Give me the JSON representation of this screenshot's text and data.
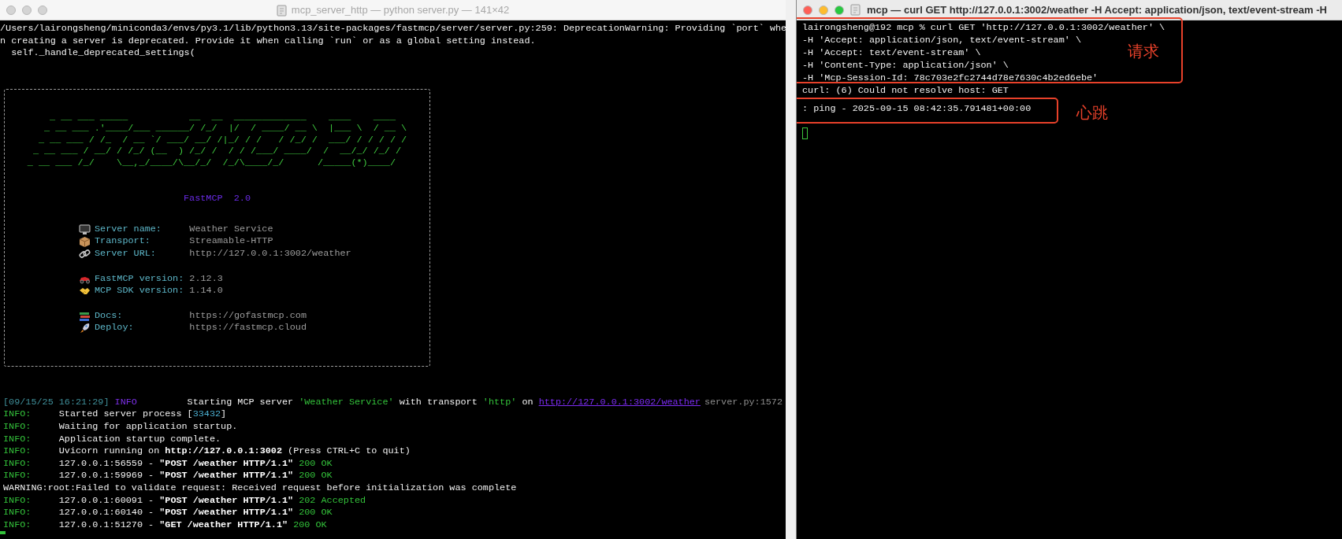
{
  "left_window": {
    "title": "mcp_server_http — python server.py — 141×42",
    "active": false,
    "output": [
      "/Users/lairongsheng/miniconda3/envs/py3.1/lib/python3.13/site-packages/fastmcp/server/server.py:259: DeprecationWarning: Providing `port` whe",
      "n creating a server is deprecated. Provide it when calling `run` or as a global setting instead.",
      "  self._handle_deprecated_settings("
    ],
    "banner": {
      "art": [
        "    _ __ ___ _____           __  __  _____________    ____    ____",
        "   _ __ ___ .'____/___ ______/ /_/  |/  / ____/ __ \\  |___ \\  / __ \\",
        "  _ __ ___ / /_  / __ `/ ___/ __/ /|_/ / /   / /_/ /  ___/ / / / / /",
        " _ __ ___ / __/ / /_/ (__  ) /_/ /  / / /___/ ____/  /  __/_/ /_/ /",
        "_ __ ___ /_/    \\__,_/____/\\__/_/  /_/\\____/_/      /_____(*)____/"
      ],
      "title": "FastMCP  2.0",
      "groups": [
        [
          {
            "kind": "monitor",
            "label": "Server name:",
            "value": "Weather Service"
          },
          {
            "kind": "package",
            "label": "Transport:",
            "value": "Streamable-HTTP"
          },
          {
            "kind": "link",
            "label": "Server URL:",
            "value": "http://127.0.0.1:3002/weather"
          }
        ],
        [
          {
            "kind": "car",
            "label": "FastMCP version:",
            "value": "2.12.3"
          },
          {
            "kind": "handshake",
            "label": "MCP SDK version:",
            "value": "1.14.0"
          }
        ],
        [
          {
            "kind": "books",
            "label": "Docs:",
            "value": "https://gofastmcp.com"
          },
          {
            "kind": "rocket",
            "label": "Deploy:",
            "value": "https://fastmcp.cloud"
          }
        ]
      ]
    },
    "log": [
      {
        "kind": "rich",
        "timestamp": "[09/15/25 16:21:29]",
        "level": "INFO",
        "segments": [
          {
            "kind": "plain",
            "text": "Starting MCP server "
          },
          {
            "kind": "quoted",
            "text": "'Weather Service'"
          },
          {
            "kind": "plain",
            "text": " with transport "
          },
          {
            "kind": "quoted",
            "text": "'http'"
          },
          {
            "kind": "plain",
            "text": " on "
          },
          {
            "kind": "url",
            "text": "http://127.0.0.1:3002/weather"
          }
        ],
        "source": "server.py:1572"
      },
      {
        "kind": "uvicorn",
        "level": "INFO:",
        "segments": [
          {
            "kind": "plain",
            "text": "Started server process ["
          },
          {
            "kind": "number",
            "text": "33432"
          },
          {
            "kind": "plain",
            "text": "]"
          }
        ]
      },
      {
        "kind": "uvicorn",
        "level": "INFO:",
        "segments": [
          {
            "kind": "plain",
            "text": "Waiting for application startup."
          }
        ]
      },
      {
        "kind": "uvicorn",
        "level": "INFO:",
        "segments": [
          {
            "kind": "plain",
            "text": "Application startup complete."
          }
        ]
      },
      {
        "kind": "uvicorn",
        "level": "INFO:",
        "segments": [
          {
            "kind": "plain",
            "text": "Uvicorn running on "
          },
          {
            "kind": "bold",
            "text": "http://127.0.0.1:3002"
          },
          {
            "kind": "plain",
            "text": " (Press CTRL+C to quit)"
          }
        ]
      },
      {
        "kind": "uvicorn",
        "level": "INFO:",
        "segments": [
          {
            "kind": "plain",
            "text": "127.0.0.1:56559 - "
          },
          {
            "kind": "bold",
            "text": "\"POST /weather HTTP/1.1\""
          },
          {
            "kind": "status",
            "text": " 200 OK"
          }
        ]
      },
      {
        "kind": "uvicorn",
        "level": "INFO:",
        "segments": [
          {
            "kind": "plain",
            "text": "127.0.0.1:59969 - "
          },
          {
            "kind": "bold",
            "text": "\"POST /weather HTTP/1.1\""
          },
          {
            "kind": "status",
            "text": " 200 OK"
          }
        ]
      },
      {
        "kind": "plain",
        "segments": [
          {
            "kind": "plain",
            "text": "WARNING:root:Failed to validate request: Received request before initialization was complete"
          }
        ]
      },
      {
        "kind": "uvicorn",
        "level": "INFO:",
        "segments": [
          {
            "kind": "plain",
            "text": "127.0.0.1:60091 - "
          },
          {
            "kind": "bold",
            "text": "\"POST /weather HTTP/1.1\""
          },
          {
            "kind": "status",
            "text": " 202 Accepted"
          }
        ]
      },
      {
        "kind": "uvicorn",
        "level": "INFO:",
        "segments": [
          {
            "kind": "plain",
            "text": "127.0.0.1:60140 - "
          },
          {
            "kind": "bold",
            "text": "\"POST /weather HTTP/1.1\""
          },
          {
            "kind": "status",
            "text": " 200 OK"
          }
        ]
      },
      {
        "kind": "uvicorn",
        "level": "INFO:",
        "segments": [
          {
            "kind": "plain",
            "text": "127.0.0.1:51270 - "
          },
          {
            "kind": "bold",
            "text": "\"GET /weather HTTP/1.1\""
          },
          {
            "kind": "status",
            "text": " 200 OK"
          }
        ]
      }
    ]
  },
  "right_window": {
    "title": "mcp — curl GET http://127.0.0.1:3002/weather -H Accept: application/json, text/event-stream -H",
    "active": true,
    "lines": [
      "lairongsheng@192 mcp % curl GET 'http://127.0.0.1:3002/weather' \\",
      "-H 'Accept: application/json, text/event-stream' \\",
      "-H 'Accept: text/event-stream' \\",
      "-H 'Content-Type: application/json' \\",
      "-H 'Mcp-Session-Id: 78c703e2fc2744d78e7630c4b2ed6ebe'",
      "curl: (6) Could not resolve host: GET",
      ": ping - 2025-09-15 08:42:35.791481+00:00"
    ],
    "annotations": [
      {
        "label": "请求"
      },
      {
        "label": "心跳"
      }
    ]
  }
}
